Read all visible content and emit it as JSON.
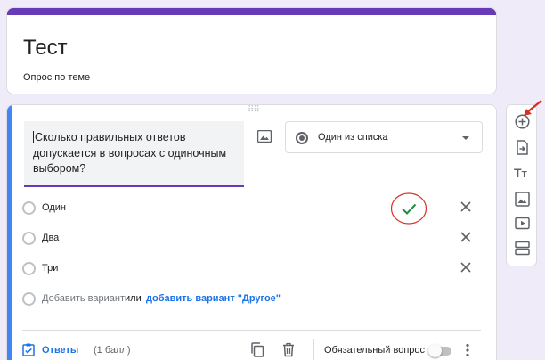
{
  "form": {
    "title": "Тест",
    "description": "Опрос по теме"
  },
  "question": {
    "text": "Сколько правильных ответов допускается в вопросах с одиночным выбором?",
    "type_label": "Один из списка",
    "options": [
      {
        "label": "Один",
        "marked_correct": true
      },
      {
        "label": "Два"
      },
      {
        "label": "Три"
      }
    ],
    "add_option_label": "Добавить вариант",
    "or_label": "или",
    "add_other_label": "добавить вариант \"Другое\"",
    "answers_label": "Ответы",
    "points_label": "(1 балл)",
    "required_label": "Обязательный вопрос",
    "required": false
  },
  "toolbar": {
    "items": [
      "add-question-icon",
      "import-questions-icon",
      "add-title-icon",
      "add-image-icon",
      "add-video-icon",
      "add-section-icon"
    ],
    "title_glyph_big": "T",
    "title_glyph_small": "T"
  },
  "colors": {
    "accent": "#673ab7",
    "active_bar": "#4285f4",
    "link": "#1a73e8",
    "correct_check": "#1e8e3e",
    "annotation_red": "#d93025",
    "background": "#f0ebf8"
  }
}
